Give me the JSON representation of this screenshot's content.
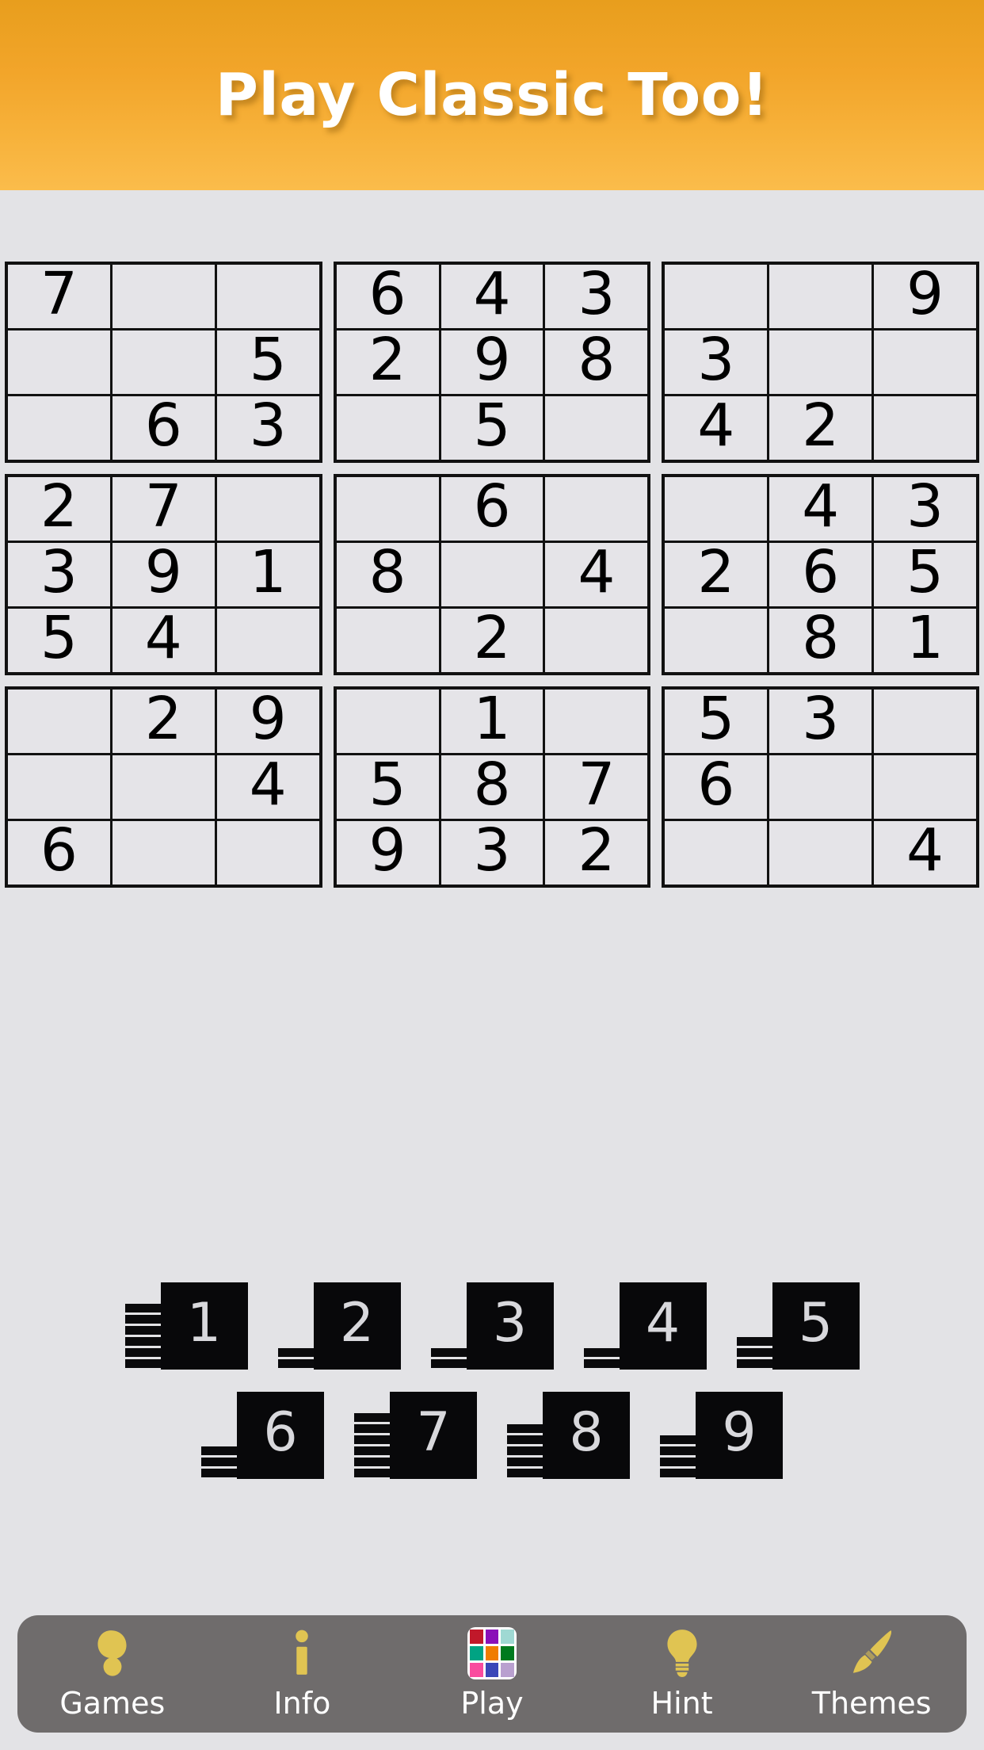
{
  "banner": {
    "title": "Play Classic Too!",
    "bg_start": "#e89e1d",
    "bg_end": "#fbbc4b",
    "text_color": "#ffffff"
  },
  "board": {
    "accent_line": "#111111",
    "cell_bg": "#e5e4e8",
    "page_bg": "#e3e3e6",
    "boxes": [
      {
        "name": "box-top-left",
        "cells": [
          "7",
          "",
          "",
          "",
          "",
          "5",
          "",
          "6",
          "3"
        ]
      },
      {
        "name": "box-top-center",
        "cells": [
          "6",
          "4",
          "3",
          "2",
          "9",
          "8",
          "",
          "5",
          ""
        ]
      },
      {
        "name": "box-top-right",
        "cells": [
          "",
          "",
          "9",
          "3",
          "",
          "",
          "4",
          "2",
          ""
        ]
      },
      {
        "name": "box-middle-left",
        "cells": [
          "2",
          "7",
          "",
          "3",
          "9",
          "1",
          "5",
          "4",
          ""
        ]
      },
      {
        "name": "box-middle-center",
        "cells": [
          "",
          "6",
          "",
          "8",
          "",
          "4",
          "",
          "2",
          ""
        ]
      },
      {
        "name": "box-middle-right",
        "cells": [
          "",
          "4",
          "3",
          "2",
          "6",
          "5",
          "",
          "8",
          "1"
        ]
      },
      {
        "name": "box-bottom-left",
        "cells": [
          "",
          "2",
          "9",
          "",
          "",
          "4",
          "6",
          "",
          ""
        ]
      },
      {
        "name": "box-bottom-center",
        "cells": [
          "",
          "1",
          "",
          "5",
          "8",
          "7",
          "9",
          "3",
          "2"
        ]
      },
      {
        "name": "box-bottom-right",
        "cells": [
          "5",
          "3",
          "",
          "6",
          "",
          "",
          "",
          "",
          "4"
        ]
      }
    ],
    "rows": [
      [
        "7",
        "",
        "",
        "6",
        "4",
        "3",
        "",
        "",
        "9"
      ],
      [
        "",
        "",
        "5",
        "2",
        "9",
        "8",
        "3",
        "",
        ""
      ],
      [
        "",
        "6",
        "3",
        "",
        "5",
        "",
        "4",
        "2",
        ""
      ],
      [
        "2",
        "7",
        "",
        "",
        "6",
        "",
        "",
        "4",
        "3"
      ],
      [
        "3",
        "9",
        "1",
        "8",
        "",
        "4",
        "2",
        "6",
        "5"
      ],
      [
        "5",
        "4",
        "",
        "",
        "2",
        "",
        "",
        "8",
        "1"
      ],
      [
        "",
        "2",
        "9",
        "",
        "1",
        "",
        "5",
        "3",
        ""
      ],
      [
        "",
        "",
        "4",
        "5",
        "8",
        "7",
        "6",
        "",
        ""
      ],
      [
        "6",
        "",
        "",
        "9",
        "3",
        "2",
        "",
        "",
        "4"
      ]
    ]
  },
  "numpad": {
    "key_bg": "#08080a",
    "key_text": "#d8d8dc",
    "row1": [
      {
        "digit": "1",
        "remaining": 6
      },
      {
        "digit": "2",
        "remaining": 2
      },
      {
        "digit": "3",
        "remaining": 2
      },
      {
        "digit": "4",
        "remaining": 2
      },
      {
        "digit": "5",
        "remaining": 3
      }
    ],
    "row2": [
      {
        "digit": "6",
        "remaining": 3
      },
      {
        "digit": "7",
        "remaining": 6
      },
      {
        "digit": "8",
        "remaining": 5
      },
      {
        "digit": "9",
        "remaining": 4
      }
    ]
  },
  "navbar": {
    "bg": "#6f6c6c",
    "icon_color": "#e0c452",
    "label_color": "#ffffff",
    "items": [
      {
        "label": "Games",
        "icon": "games-swirl-icon"
      },
      {
        "label": "Info",
        "icon": "info-icon"
      },
      {
        "label": "Play",
        "icon": "play-grid-icon"
      },
      {
        "label": "Hint",
        "icon": "lightbulb-icon"
      },
      {
        "label": "Themes",
        "icon": "paintbrush-icon"
      }
    ],
    "play_grid_colors": [
      "#c1182a",
      "#8a10b8",
      "#9fd9d3",
      "#00a383",
      "#f07c00",
      "#007a1e",
      "#f94b9e",
      "#3a46b8",
      "#b9a0cf"
    ]
  }
}
